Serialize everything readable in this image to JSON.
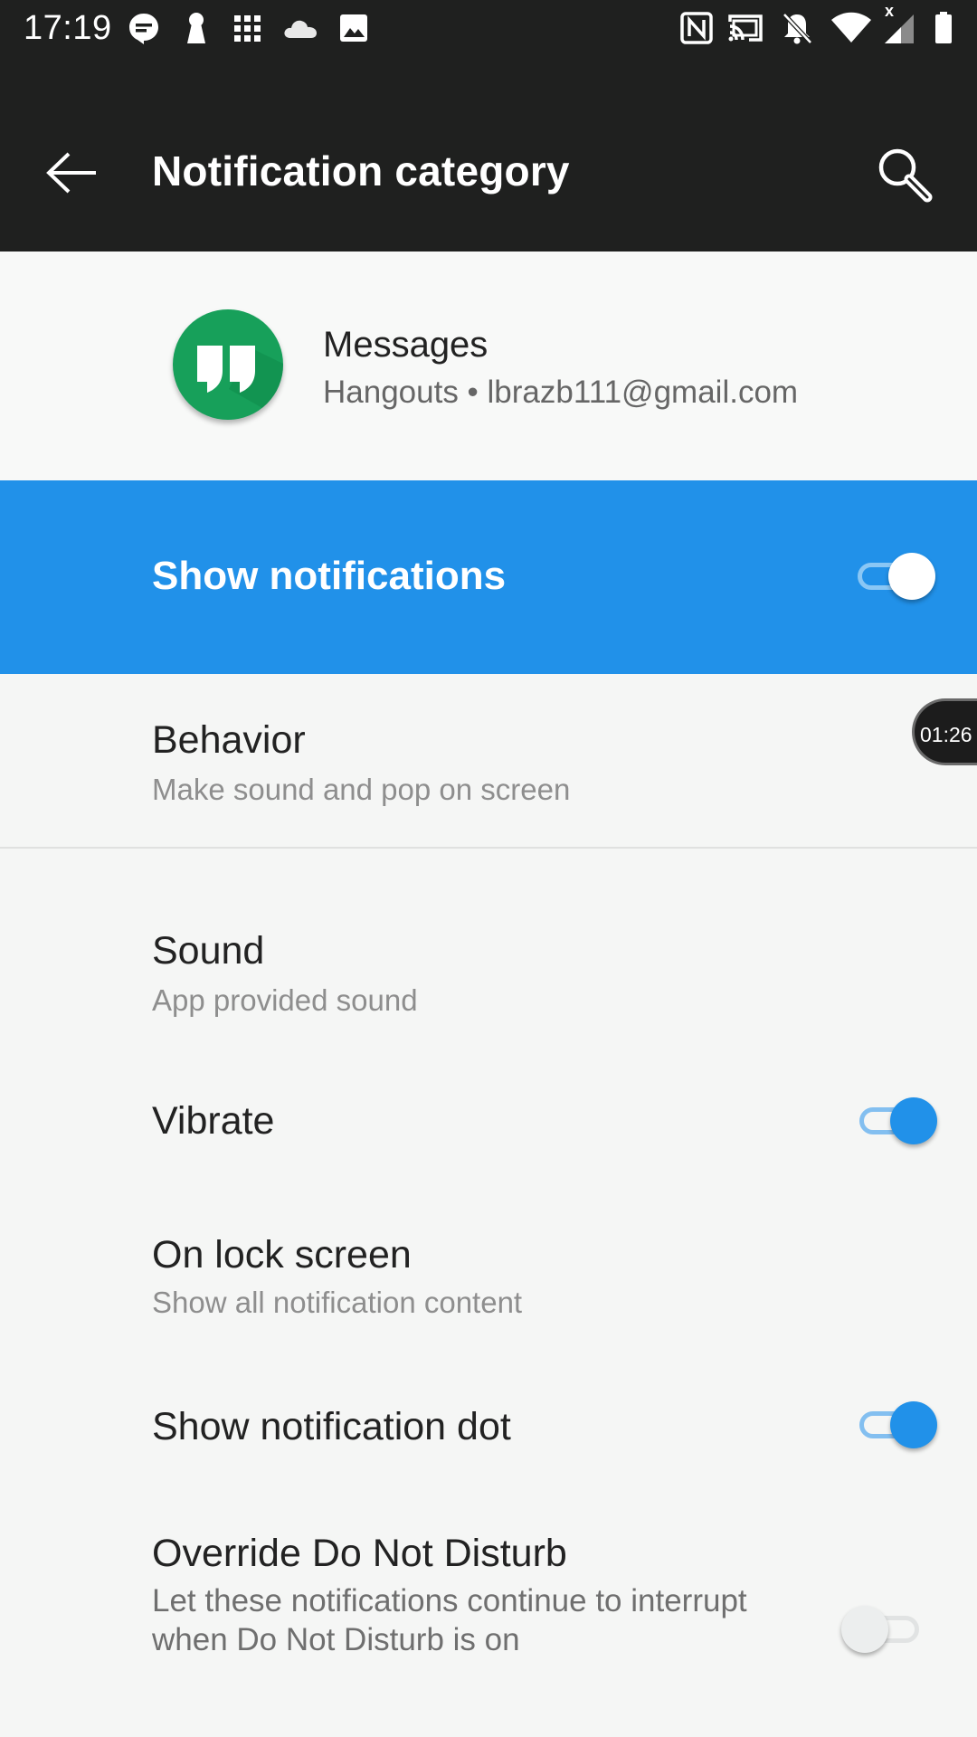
{
  "status_bar": {
    "time": "17:19",
    "left_icons": [
      "chat-bubble-icon",
      "keyhole-icon",
      "grid-icon",
      "cloud-icon",
      "image-icon"
    ],
    "right_icons": [
      "nfc-icon",
      "cast-icon",
      "notifications-off-icon",
      "wifi-icon",
      "cellular-signal-icon",
      "battery-icon"
    ],
    "signal_status_text": "x"
  },
  "app_bar": {
    "title": "Notification category",
    "back_icon": "arrow-back-icon",
    "search_icon": "search-icon"
  },
  "header": {
    "title": "Messages",
    "subtitle": "Hangouts • lbrazb111@gmail.com",
    "app_icon": "hangouts-icon"
  },
  "master_switch": {
    "label": "Show notifications",
    "checked": true
  },
  "settings": {
    "behavior": {
      "title": "Behavior",
      "summary": "Make sound and pop on screen"
    },
    "sound": {
      "title": "Sound",
      "summary": "App provided sound"
    },
    "vibrate": {
      "title": "Vibrate",
      "checked": true
    },
    "lock_screen": {
      "title": "On lock screen",
      "summary": "Show all notification content"
    },
    "notification_dot": {
      "title": "Show notification dot",
      "checked": true
    },
    "override_dnd": {
      "title": "Override Do Not Disturb",
      "summary": "Let these notifications continue to interrupt when Do Not Disturb is on",
      "checked": false
    }
  },
  "timer_bubble": {
    "text": "01:26"
  },
  "colors": {
    "accent": "#2191e9",
    "app_bar": "#1f201f",
    "background": "#f5f6f5",
    "hangouts_green": "#17a05a"
  }
}
